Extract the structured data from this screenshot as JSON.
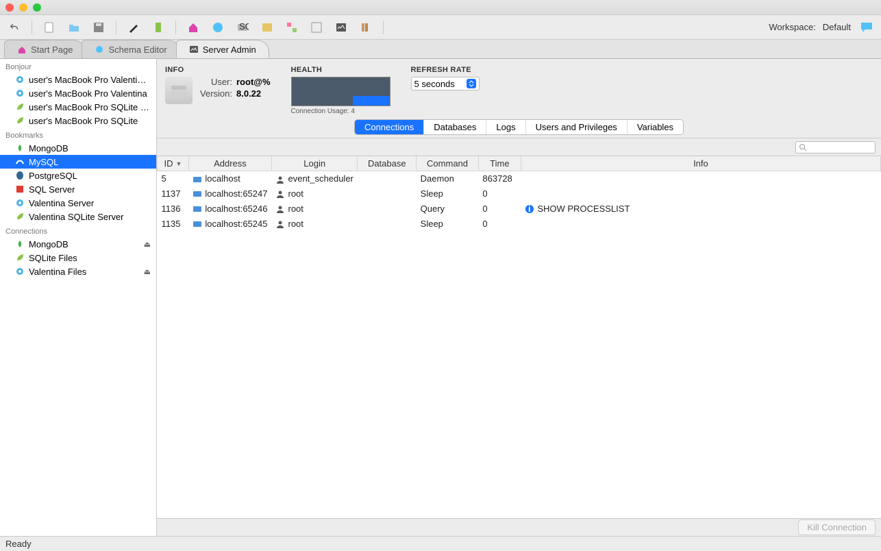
{
  "workspace": {
    "label": "Workspace:",
    "value": "Default"
  },
  "tabs": [
    {
      "label": "Start Page",
      "active": false
    },
    {
      "label": "Schema Editor",
      "active": false
    },
    {
      "label": "Server Admin",
      "active": true
    }
  ],
  "sidebar": {
    "sections": [
      {
        "title": "Bonjour",
        "items": [
          {
            "label": "user's MacBook Pro Valentina (S...",
            "icon": "gear"
          },
          {
            "label": "user's MacBook Pro Valentina",
            "icon": "gear"
          },
          {
            "label": "user's MacBook Pro SQLite (SSL)",
            "icon": "leaf"
          },
          {
            "label": "user's MacBook Pro SQLite",
            "icon": "leaf"
          }
        ]
      },
      {
        "title": "Bookmarks",
        "items": [
          {
            "label": "MongoDB",
            "icon": "mongo"
          },
          {
            "label": "MySQL",
            "icon": "mysql",
            "selected": true
          },
          {
            "label": "PostgreSQL",
            "icon": "pg"
          },
          {
            "label": "SQL Server",
            "icon": "mssql"
          },
          {
            "label": "Valentina Server",
            "icon": "gear"
          },
          {
            "label": "Valentina SQLite Server",
            "icon": "leaf"
          }
        ]
      },
      {
        "title": "Connections",
        "items": [
          {
            "label": "MongoDB",
            "icon": "mongo",
            "eject": true
          },
          {
            "label": "SQLite Files",
            "icon": "leaf"
          },
          {
            "label": "Valentina Files",
            "icon": "gear",
            "eject": true
          }
        ]
      }
    ]
  },
  "info": {
    "heading": "INFO",
    "user_label": "User:",
    "user_value": "root@%",
    "version_label": "Version:",
    "version_value": "8.0.22"
  },
  "health": {
    "heading": "HEALTH",
    "caption": "Connection Usage: 4"
  },
  "refresh": {
    "heading": "REFRESH RATE",
    "value": "5 seconds"
  },
  "segments": [
    "Connections",
    "Databases",
    "Logs",
    "Users and Privileges",
    "Variables"
  ],
  "segment_active": 0,
  "table": {
    "columns": [
      "ID",
      "Address",
      "Login",
      "Database",
      "Command",
      "Time",
      "Info"
    ],
    "rows": [
      {
        "id": "5",
        "address": "localhost",
        "login": "event_scheduler",
        "database": "",
        "command": "Daemon",
        "time": "863728",
        "info": ""
      },
      {
        "id": "1137",
        "address": "localhost:65247",
        "login": "root",
        "database": "",
        "command": "Sleep",
        "time": "0",
        "info": ""
      },
      {
        "id": "1136",
        "address": "localhost:65246",
        "login": "root",
        "database": "",
        "command": "Query",
        "time": "0",
        "info": "SHOW PROCESSLIST",
        "info_icon": true
      },
      {
        "id": "1135",
        "address": "localhost:65245",
        "login": "root",
        "database": "",
        "command": "Sleep",
        "time": "0",
        "info": ""
      }
    ]
  },
  "kill_button": "Kill Connection",
  "status": "Ready",
  "icons": {
    "gear": "gear",
    "leaf": "leaf"
  }
}
